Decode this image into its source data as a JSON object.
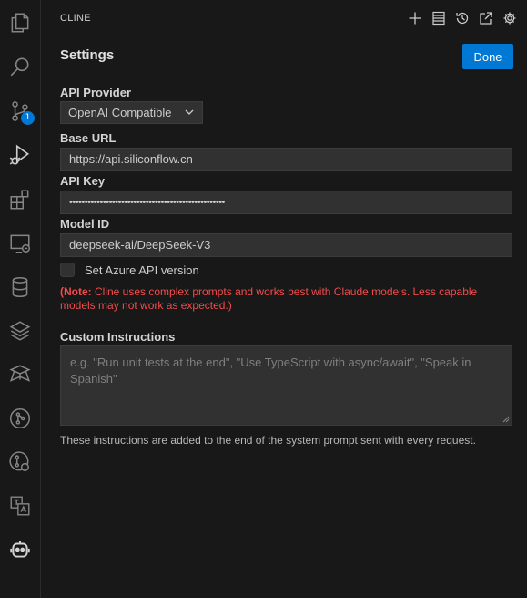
{
  "panel": {
    "title": "CLINE",
    "header_actions": [
      "plus-icon",
      "history-list-icon",
      "history-icon",
      "popout-icon",
      "gear-icon"
    ]
  },
  "activity_bar": {
    "icons": [
      "explorer-icon",
      "search-icon",
      "source-control-icon",
      "run-debug-icon",
      "extensions-icon",
      "remote-explorer-icon",
      "database-icon",
      "layers-icon",
      "deploy-icon",
      "git-graph-icon",
      "git-lens-icon",
      "translate-icon",
      "cline-robot-icon"
    ],
    "source_control_badge": "1"
  },
  "settings": {
    "title": "Settings",
    "done_label": "Done",
    "api_provider_label": "API Provider",
    "api_provider_value": "OpenAI Compatible",
    "base_url_label": "Base URL",
    "base_url_value": "https://api.siliconflow.cn",
    "api_key_label": "API Key",
    "api_key_value": "•••••••••••••••••••••••••••••••••••••••••••••••••••",
    "model_id_label": "Model ID",
    "model_id_value": "deepseek-ai/DeepSeek-V3",
    "azure_checkbox_label": "Set Azure API version",
    "azure_checked": false,
    "note_prefix": "(Note:",
    "note_text": " Cline uses complex prompts and works best with Claude models. Less capable models may not work as expected.)",
    "custom_instructions_label": "Custom Instructions",
    "custom_instructions_placeholder": "e.g. \"Run unit tests at the end\", \"Use TypeScript with async/await\", \"Speak in Spanish\"",
    "custom_instructions_help": "These instructions are added to the end of the system prompt sent with every request."
  },
  "colors": {
    "accent": "#0078d4",
    "warning": "#f14c4c",
    "background": "#181818"
  }
}
